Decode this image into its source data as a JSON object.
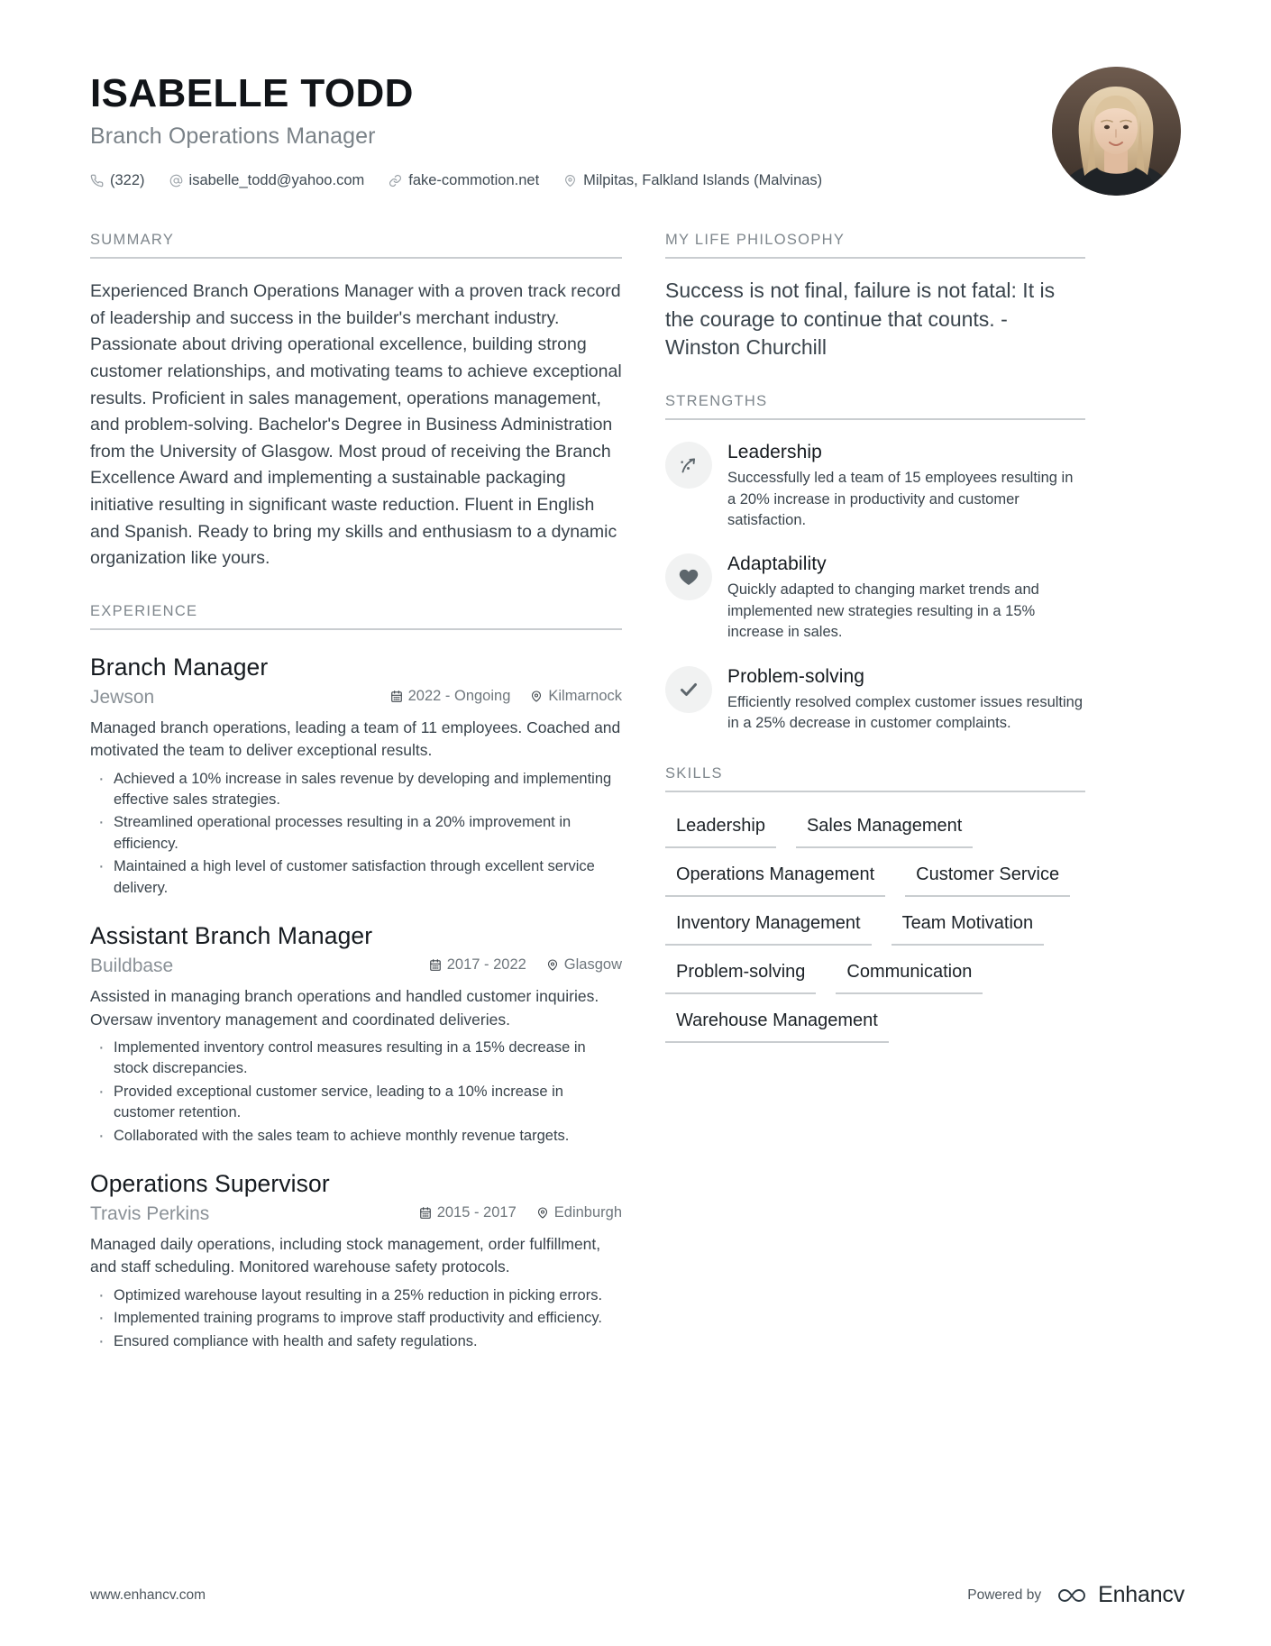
{
  "header": {
    "name": "ISABELLE TODD",
    "role": "Branch Operations Manager",
    "contacts": [
      {
        "icon": "phone-icon",
        "text": "(322)"
      },
      {
        "icon": "email-icon",
        "text": "isabelle_todd@yahoo.com"
      },
      {
        "icon": "link-icon",
        "text": "fake-commotion.net"
      },
      {
        "icon": "location-pin-icon",
        "text": "Milpitas, Falkland Islands (Malvinas)"
      }
    ]
  },
  "summary": {
    "title": "SUMMARY",
    "text": "Experienced Branch Operations Manager with a proven track record of leadership and success in the builder's merchant industry. Passionate about driving operational excellence, building strong customer relationships, and motivating teams to achieve exceptional results. Proficient in sales management, operations management, and problem-solving. Bachelor's Degree in Business Administration from the University of Glasgow. Most proud of receiving the Branch Excellence Award and implementing a sustainable packaging initiative resulting in significant waste reduction. Fluent in English and Spanish. Ready to bring my skills and enthusiasm to a dynamic organization like yours."
  },
  "experience": {
    "title": "EXPERIENCE",
    "entries": [
      {
        "role": "Branch Manager",
        "company": "Jewson",
        "dates": "2022 - Ongoing",
        "location": "Kilmarnock",
        "description": "Managed branch operations, leading a team of 11 employees. Coached and motivated the team to deliver exceptional results.",
        "bullets": [
          "Achieved a 10% increase in sales revenue by developing and implementing effective sales strategies.",
          "Streamlined operational processes resulting in a 20% improvement in efficiency.",
          "Maintained a high level of customer satisfaction through excellent service delivery."
        ]
      },
      {
        "role": "Assistant Branch Manager",
        "company": "Buildbase",
        "dates": "2017 - 2022",
        "location": "Glasgow",
        "description": "Assisted in managing branch operations and handled customer inquiries. Oversaw inventory management and coordinated deliveries.",
        "bullets": [
          "Implemented inventory control measures resulting in a 15% decrease in stock discrepancies.",
          "Provided exceptional customer service, leading to a 10% increase in customer retention.",
          "Collaborated with the sales team to achieve monthly revenue targets."
        ]
      },
      {
        "role": "Operations Supervisor",
        "company": "Travis Perkins",
        "dates": "2015 - 2017",
        "location": "Edinburgh",
        "description": "Managed daily operations, including stock management, order fulfillment, and staff scheduling. Monitored warehouse safety protocols.",
        "bullets": [
          "Optimized warehouse layout resulting in a 25% reduction in picking errors.",
          "Implemented training programs to improve staff productivity and efficiency.",
          "Ensured compliance with health and safety regulations."
        ]
      }
    ]
  },
  "philosophy": {
    "title": "MY LIFE PHILOSOPHY",
    "quote": "Success is not final, failure is not fatal: It is the courage to continue that counts. - Winston Churchill"
  },
  "strengths": {
    "title": "STRENGTHS",
    "items": [
      {
        "icon": "rocket-trajectory-icon",
        "name": "Leadership",
        "description": "Successfully led a team of 15 employees resulting in a 20% increase in productivity and customer satisfaction."
      },
      {
        "icon": "heart-icon",
        "name": "Adaptability",
        "description": "Quickly adapted to changing market trends and implemented new strategies resulting in a 15% increase in sales."
      },
      {
        "icon": "check-icon",
        "name": "Problem-solving",
        "description": "Efficiently resolved complex customer issues resulting in a 25% decrease in customer complaints."
      }
    ]
  },
  "skills": {
    "title": "SKILLS",
    "items": [
      "Leadership",
      "Sales Management",
      "Operations Management",
      "Customer Service",
      "Inventory Management",
      "Team Motivation",
      "Problem-solving",
      "Communication",
      "Warehouse Management"
    ]
  },
  "footer": {
    "url": "www.enhancv.com",
    "powered_by": "Powered by",
    "brand": "Enhancv"
  },
  "colors": {
    "accent_rule": "#c9cdd0",
    "muted_text": "#7e868c",
    "body_text": "#39434b",
    "icon_bg": "#f1f2f2"
  }
}
